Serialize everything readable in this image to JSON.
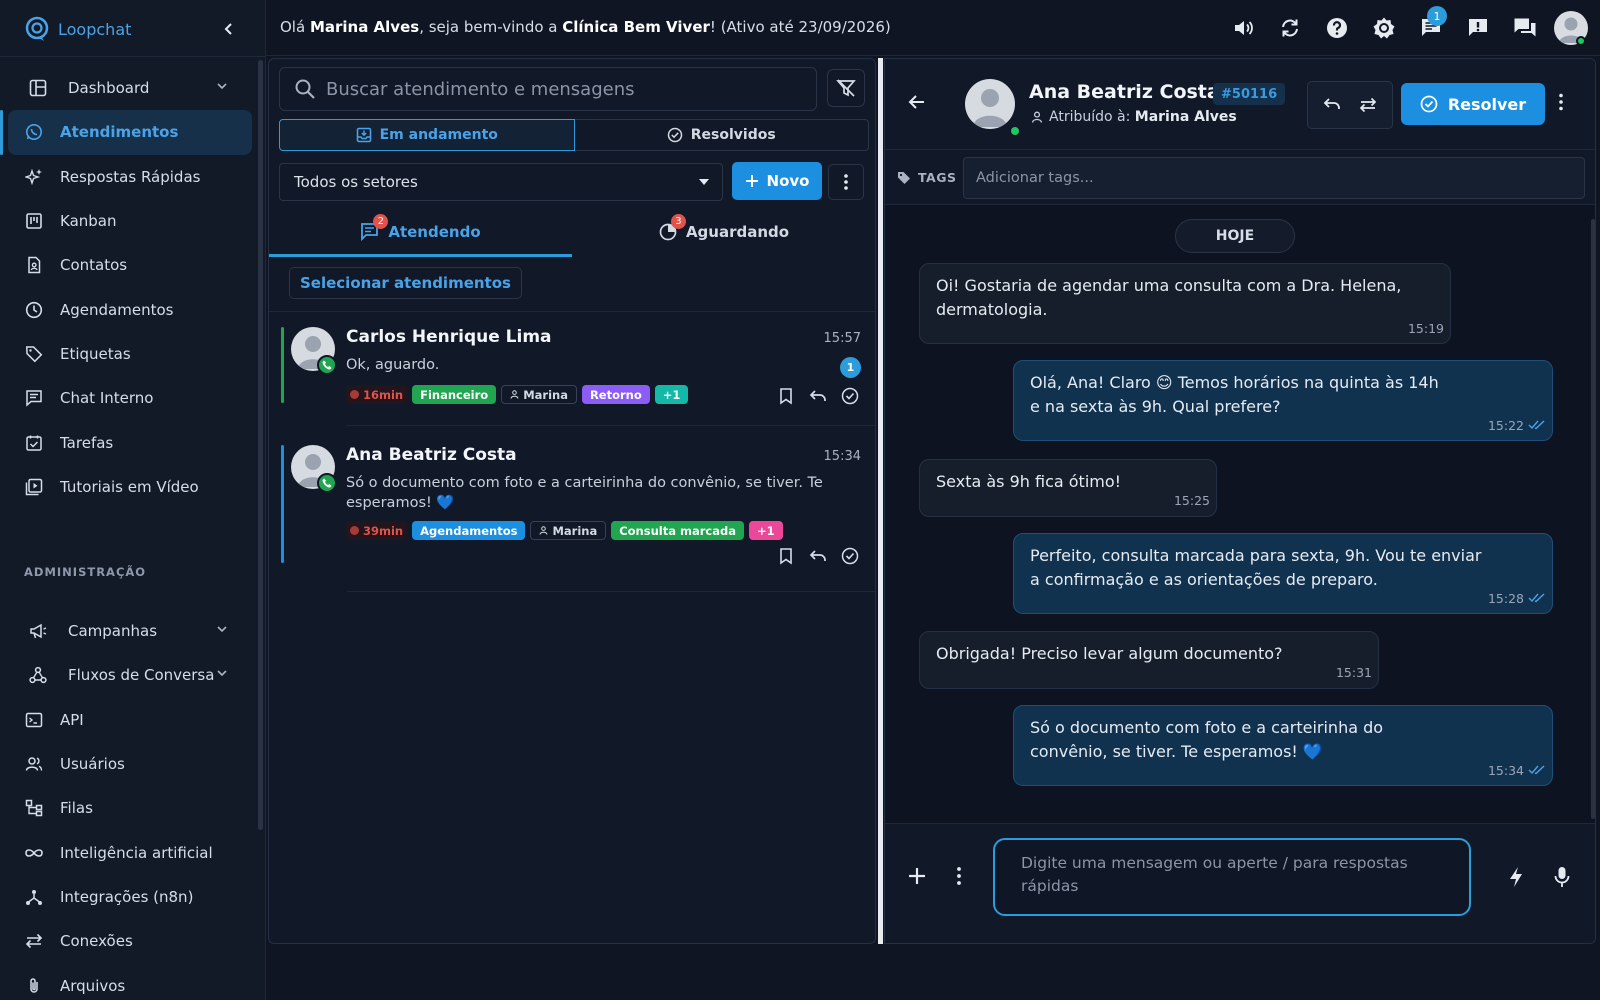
{
  "brand": {
    "name": "Loopchat",
    "name_part1": "Loop",
    "name_part2": "chat"
  },
  "welcome": {
    "prefix": "Olá ",
    "user": "Marina Alves",
    "middle": ", seja bem-vindo a ",
    "clinic": "Clínica Bem Viver",
    "suffix": "! (Ativo até 23/09/2026)"
  },
  "topbar": {
    "notification_count": "1"
  },
  "sidebar": {
    "items": [
      {
        "label": "Dashboard",
        "icon": "dashboard-icon",
        "expandable": true
      },
      {
        "label": "Atendimentos",
        "icon": "whatsapp-icon",
        "active": true
      },
      {
        "label": "Respostas Rápidas",
        "icon": "sparkle-icon"
      },
      {
        "label": "Kanban",
        "icon": "kanban-icon"
      },
      {
        "label": "Contatos",
        "icon": "contact-book-icon"
      },
      {
        "label": "Agendamentos",
        "icon": "clock-icon"
      },
      {
        "label": "Etiquetas",
        "icon": "tag-icon"
      },
      {
        "label": "Chat Interno",
        "icon": "chat-icon"
      },
      {
        "label": "Tarefas",
        "icon": "task-icon"
      },
      {
        "label": "Tutoriais em Vídeo",
        "icon": "video-icon"
      }
    ],
    "admin_title": "ADMINISTRAÇÃO",
    "admin_items": [
      {
        "label": "Campanhas",
        "icon": "megaphone-icon",
        "expandable": true
      },
      {
        "label": "Fluxos de Conversa",
        "icon": "flow-icon",
        "expandable": true
      },
      {
        "label": "API",
        "icon": "terminal-icon"
      },
      {
        "label": "Usuários",
        "icon": "users-icon"
      },
      {
        "label": "Filas",
        "icon": "queue-icon"
      },
      {
        "label": "Inteligência artificial",
        "icon": "infinity-icon"
      },
      {
        "label": "Integrações (n8n)",
        "icon": "integration-icon"
      },
      {
        "label": "Conexões",
        "icon": "swap-icon"
      },
      {
        "label": "Arquivos",
        "icon": "paperclip-icon"
      }
    ]
  },
  "list": {
    "search_placeholder": "Buscar atendimento e mensagens",
    "status_tabs": [
      "Em andamento",
      "Resolvidos"
    ],
    "sector": "Todos os setores",
    "new_label": "Novo",
    "sub_tabs": [
      {
        "label": "Atendendo",
        "badge": "2"
      },
      {
        "label": "Aguardando",
        "badge": "3"
      }
    ],
    "select_label": "Selecionar atendimentos",
    "tickets": [
      {
        "name": "Carlos Henrique Lima",
        "time": "15:57",
        "message": "Ok, aguardo.",
        "unread": "1",
        "bar_color": "#22a551",
        "tags": [
          {
            "text": "16min",
            "kind": "timer"
          },
          {
            "text": "Financeiro",
            "color": "#22a551"
          },
          {
            "text": "Marina",
            "kind": "user"
          },
          {
            "text": "Retorno",
            "color": "#8b5cf6"
          },
          {
            "text": "+1",
            "color": "#14b8a6"
          }
        ]
      },
      {
        "name": "Ana Beatriz Costa",
        "time": "15:34",
        "message": "Só o documento com foto e a carteirinha do convênio, se tiver. Te esperamos! 💙",
        "bar_color": "#1d8fe0",
        "tags": [
          {
            "text": "39min",
            "kind": "timer"
          },
          {
            "text": "Agendamentos",
            "color": "#1d8fe0"
          },
          {
            "text": "Marina",
            "kind": "user"
          },
          {
            "text": "Consulta marcada",
            "color": "#22a551"
          },
          {
            "text": "+1",
            "color": "#ec4899"
          }
        ]
      }
    ]
  },
  "chat": {
    "contact_name": "Ana Beatriz Costa",
    "ticket_id": "#50116",
    "assigned_prefix": "Atribuído à: ",
    "assigned_to": "Marina Alves",
    "resolve_label": "Resolver",
    "tags_label": "TAGS",
    "tags_placeholder": "Adicionar tags...",
    "day_label": "HOJE",
    "messages": [
      {
        "dir": "in",
        "text": "Oi! Gostaria de agendar uma consulta com a Dra. Helena, dermatologia.",
        "time": "15:19"
      },
      {
        "dir": "out",
        "text": "Olá, Ana! Claro 😊 Temos horários na quinta às 14h e na sexta às 9h. Qual prefere?",
        "time": "15:22"
      },
      {
        "dir": "in",
        "text": "Sexta às 9h fica ótimo!",
        "time": "15:25"
      },
      {
        "dir": "out",
        "text": "Perfeito, consulta marcada para sexta, 9h. Vou te enviar a confirmação e as orientações de preparo.",
        "time": "15:28"
      },
      {
        "dir": "in",
        "text": "Obrigada! Preciso levar algum documento?",
        "time": "15:31"
      },
      {
        "dir": "out",
        "text": "Só o documento com foto e a carteirinha do convênio, se tiver. Te esperamos! 💙",
        "time": "15:34"
      }
    ],
    "composer_placeholder": "Digite uma mensagem ou aperte / para respostas rápidas"
  }
}
